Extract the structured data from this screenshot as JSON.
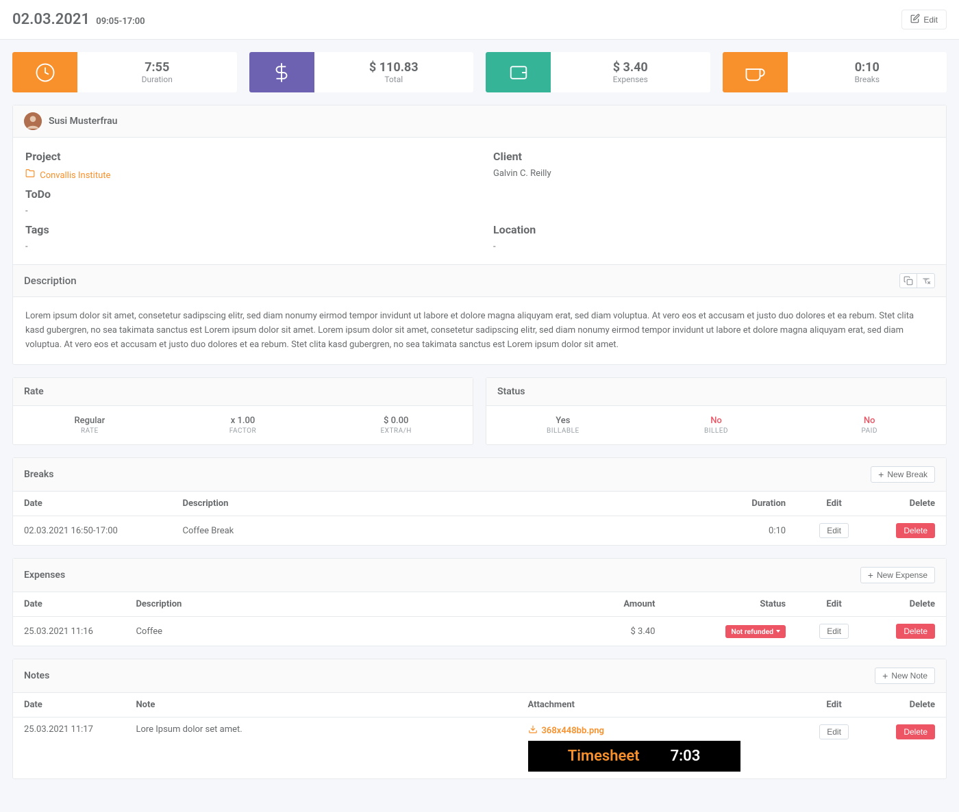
{
  "header": {
    "date": "02.03.2021",
    "time": "09:05-17:00",
    "edit_label": "Edit"
  },
  "stats": {
    "duration": {
      "value": "7:55",
      "label": "Duration"
    },
    "total": {
      "value": "$ 110.83",
      "label": "Total"
    },
    "expenses": {
      "value": "$ 3.40",
      "label": "Expenses"
    },
    "breaks": {
      "value": "0:10",
      "label": "Breaks"
    }
  },
  "user": {
    "name": "Susi Musterfrau"
  },
  "fields": {
    "project": {
      "label": "Project",
      "value": "Convallis Institute"
    },
    "client": {
      "label": "Client",
      "value": "Galvin C. Reilly"
    },
    "todo": {
      "label": "ToDo",
      "value": "-"
    },
    "tags": {
      "label": "Tags",
      "value": "-"
    },
    "location": {
      "label": "Location",
      "value": "-"
    }
  },
  "description": {
    "title": "Description",
    "text": "Lorem ipsum dolor sit amet, consetetur sadipscing elitr, sed diam nonumy eirmod tempor invidunt ut labore et dolore magna aliquyam erat, sed diam voluptua. At vero eos et accusam et justo duo dolores et ea rebum. Stet clita kasd gubergren, no sea takimata sanctus est Lorem ipsum dolor sit amet. Lorem ipsum dolor sit amet, consetetur sadipscing elitr, sed diam nonumy eirmod tempor invidunt ut labore et dolore magna aliquyam erat, sed diam voluptua. At vero eos et accusam et justo duo dolores et ea rebum. Stet clita kasd gubergren, no sea takimata sanctus est Lorem ipsum dolor sit amet."
  },
  "rate": {
    "title": "Rate",
    "items": [
      {
        "value": "Regular",
        "sub": "RATE"
      },
      {
        "value": "x 1.00",
        "sub": "FACTOR"
      },
      {
        "value": "$ 0.00",
        "sub": "EXTRA/H"
      }
    ]
  },
  "status": {
    "title": "Status",
    "items": [
      {
        "value": "Yes",
        "sub": "BILLABLE",
        "red": false
      },
      {
        "value": "No",
        "sub": "BILLED",
        "red": true
      },
      {
        "value": "No",
        "sub": "PAID",
        "red": true
      }
    ]
  },
  "breaks_section": {
    "title": "Breaks",
    "new_label": "New Break",
    "cols": {
      "date": "Date",
      "desc": "Description",
      "duration": "Duration",
      "edit": "Edit",
      "delete": "Delete"
    },
    "rows": [
      {
        "date": "02.03.2021 16:50-17:00",
        "desc": "Coffee Break",
        "duration": "0:10",
        "edit": "Edit",
        "delete": "Delete"
      }
    ]
  },
  "expenses_section": {
    "title": "Expenses",
    "new_label": "New Expense",
    "cols": {
      "date": "Date",
      "desc": "Description",
      "amount": "Amount",
      "status": "Status",
      "edit": "Edit",
      "delete": "Delete"
    },
    "rows": [
      {
        "date": "25.03.2021 11:16",
        "desc": "Coffee",
        "amount": "$ 3.40",
        "status": "Not refunded",
        "edit": "Edit",
        "delete": "Delete"
      }
    ]
  },
  "notes_section": {
    "title": "Notes",
    "new_label": "New Note",
    "cols": {
      "date": "Date",
      "note": "Note",
      "attachment": "Attachment",
      "edit": "Edit",
      "delete": "Delete"
    },
    "rows": [
      {
        "date": "25.03.2021 11:17",
        "note": "Lore Ipsum dolor set amet.",
        "attachment": "368x448bb.png",
        "edit": "Edit",
        "delete": "Delete"
      }
    ]
  },
  "preview": {
    "title": "Timesheet",
    "time": "7:03"
  }
}
